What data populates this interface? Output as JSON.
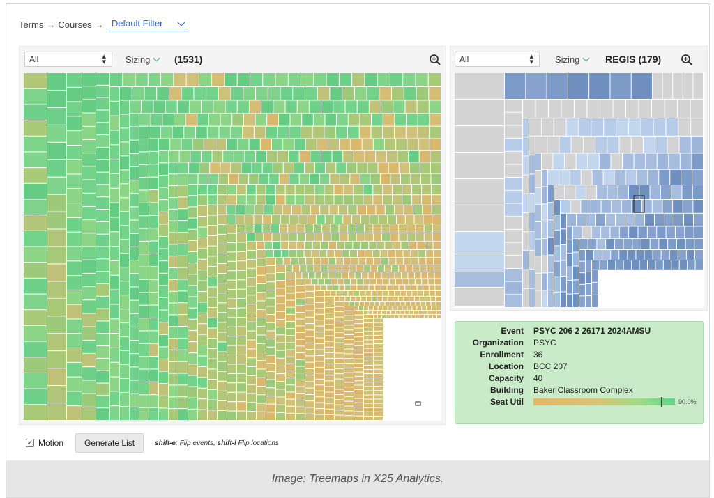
{
  "breadcrumb": {
    "terms": "Terms",
    "arrow1": "→",
    "courses": "Courses",
    "arrow2": "→",
    "filter": "Default Filter"
  },
  "left_panel": {
    "select_value": "All",
    "sizing_label": "Sizing",
    "count": "(1531)",
    "zoom_icon": "zoom-in-icon"
  },
  "right_panel": {
    "select_value": "All",
    "sizing_label": "Sizing",
    "title": "REGIS (179)",
    "zoom_icon": "zoom-in-icon"
  },
  "info": {
    "event_label": "Event",
    "event_value": "PSYC 206 2 26171 2024AMSU",
    "org_label": "Organization",
    "org_value": "PSYC",
    "enrollment_label": "Enrollment",
    "enrollment_value": "36",
    "location_label": "Location",
    "location_value": "BCC 207",
    "capacity_label": "Capacity",
    "capacity_value": "40",
    "building_label": "Building",
    "building_value": "Baker Classroom Complex",
    "seat_util_label": "Seat Util",
    "seat_util_value": 0.9,
    "seat_util_text": "90.0%"
  },
  "controls": {
    "motion_label": "Motion",
    "motion_checked": true,
    "generate_label": "Generate List",
    "hint_key1": "shift-e",
    "hint_text1": ": Flip events, ",
    "hint_key2": "shift-l",
    "hint_text2": " Flip locations"
  },
  "caption": "Image: Treemaps in X25 Analytics.",
  "colors": {
    "green": "#6fd08a",
    "olive": "#a8c978",
    "tan": "#d9b86e",
    "gray": "#d3d3d3",
    "blue_light": "#c2d6ee",
    "blue_mid": "#a7bedf",
    "blue_dark": "#7d9bc7",
    "info_bg": "#c9ebc8",
    "link": "#2a63c4"
  }
}
